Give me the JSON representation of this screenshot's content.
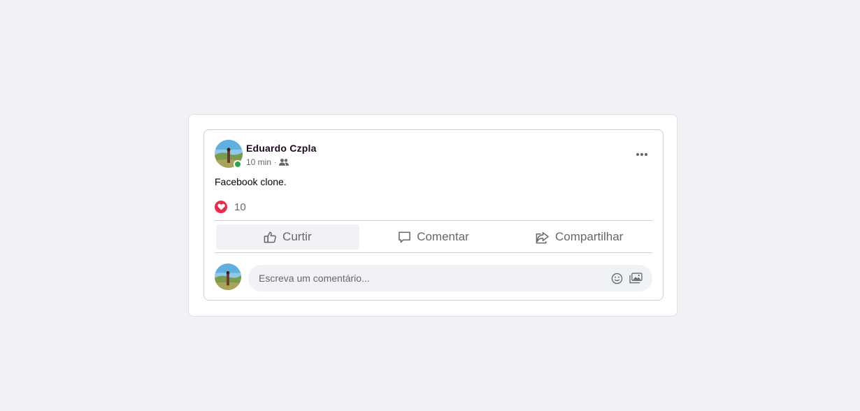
{
  "post": {
    "author": "Eduardo Czpla",
    "time": "10 min",
    "separator": "·",
    "audience_icon": "friends-icon",
    "text": "Facebook clone.",
    "reaction_icon": "heart-icon",
    "reaction_count": "10",
    "more_icon": "more-options-icon",
    "online": true
  },
  "actions": [
    {
      "label": "Curtir",
      "icon": "thumbs-up-icon",
      "active": true
    },
    {
      "label": "Comentar",
      "icon": "comment-icon",
      "active": false
    },
    {
      "label": "Compartilhar",
      "icon": "share-icon",
      "active": false
    }
  ],
  "comment": {
    "placeholder": "Escreva um comentário...",
    "emoji_icon": "emoji-icon",
    "photo_icon": "photo-icon"
  },
  "colors": {
    "background": "#f0f2f5",
    "online": "#31a24c",
    "heart": "#f02849",
    "secondary_text": "#65676b"
  }
}
